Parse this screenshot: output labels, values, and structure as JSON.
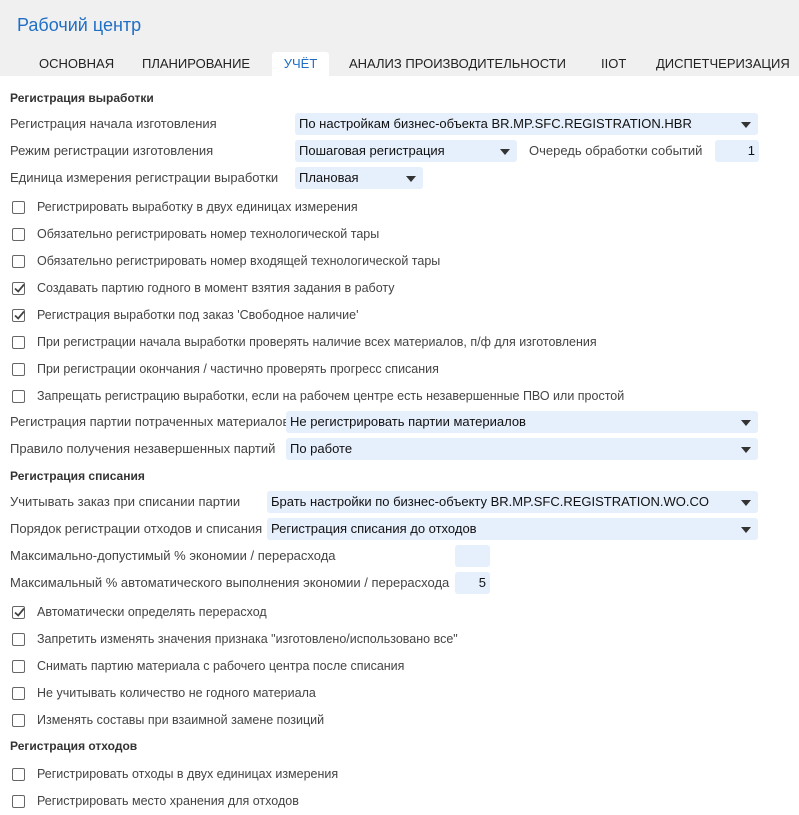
{
  "window": {
    "title": "Рабочий центр"
  },
  "tabs": [
    "ОСНОВНАЯ",
    "ПЛАНИРОВАНИЕ",
    "УЧЁТ",
    "АНАЛИЗ ПРОИЗВОДИТЕЛЬНОСТИ",
    "IIOT",
    "ДИСПЕТЧЕРИЗАЦИЯ"
  ],
  "active_tab": "УЧЁТ",
  "output": {
    "section_title": "Регистрация выработки",
    "start_registration": {
      "label": "Регистрация начала изготовления",
      "value": "По настройкам бизнес-объекта BR.MP.SFC.REGISTRATION.HBR"
    },
    "registration_mode": {
      "label": "Режим регистрации изготовления",
      "value": "Пошаговая регистрация"
    },
    "event_queue": {
      "label": "Очередь обработки событий",
      "value": "1"
    },
    "unit": {
      "label": "Единица измерения регистрации выработки",
      "value": "Плановая"
    },
    "checkboxes": [
      {
        "label": "Регистрировать выработку в двух единицах измерения",
        "checked": false
      },
      {
        "label": "Обязательно регистрировать номер технологической тары",
        "checked": false
      },
      {
        "label": "Обязательно регистрировать номер входящей технологической тары",
        "checked": false
      },
      {
        "label": "Создавать партию годного в момент взятия задания в работу",
        "checked": true
      },
      {
        "label": "Регистрация выработки под заказ 'Свободное наличие'",
        "checked": true
      },
      {
        "label": "При регистрации начала выработки проверять наличие всех материалов, п/ф для изготовления",
        "checked": false
      },
      {
        "label": "При регистрации окончания / частично проверять прогресс списания",
        "checked": false
      },
      {
        "label": "Запрещать регистрацию выработки, если на рабочем центре есть незавершенные ПВО или простой",
        "checked": false
      }
    ],
    "material_batch": {
      "label": "Регистрация партии потраченных материалов",
      "value": "Не регистрировать партии материалов"
    },
    "unfinished_batch": {
      "label": "Правило получения незавершенных партий",
      "value": "По работе"
    }
  },
  "writeoff": {
    "section_title": "Регистрация списания",
    "batch_order": {
      "label": "Учитывать заказ при списании партии",
      "value": "Брать настройки по бизнес-объекту BR.MP.SFC.REGISTRATION.WO.CO"
    },
    "waste_order": {
      "label": "Порядок регистрации отходов и списания",
      "value": "Регистрация списания до отходов"
    },
    "max_percent": {
      "label": "Максимально-допустимый % экономии / перерасхода",
      "value": ""
    },
    "max_auto_percent": {
      "label": "Максимальный % автоматического выполнения экономии / перерасхода",
      "value": "5"
    },
    "checkboxes": [
      {
        "label": "Автоматически определять перерасход",
        "checked": true
      },
      {
        "label": "Запретить изменять значения признака \"изготовлено/использовано все\"",
        "checked": false
      },
      {
        "label": "Снимать партию материала с рабочего центра после списания",
        "checked": false
      },
      {
        "label": "Не учитывать количество не годного материала",
        "checked": false
      },
      {
        "label": "Изменять составы при взаимной замене позиций",
        "checked": false
      }
    ]
  },
  "waste": {
    "section_title": "Регистрация отходов",
    "checkboxes": [
      {
        "label": "Регистрировать отходы в двух единицах измерения",
        "checked": false
      },
      {
        "label": "Регистрировать место хранения для отходов",
        "checked": false
      }
    ]
  }
}
